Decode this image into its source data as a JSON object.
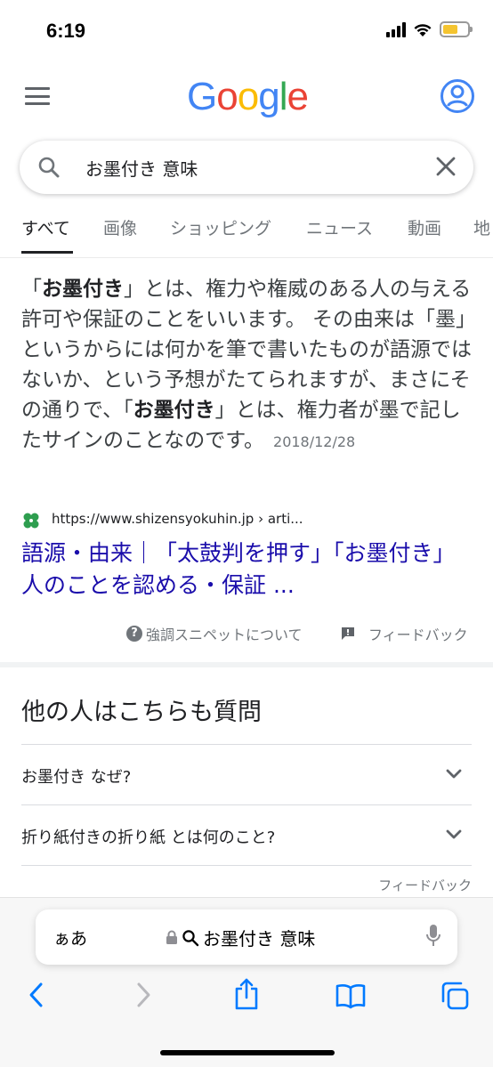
{
  "status": {
    "time": "6:19",
    "battery_level": 0.6
  },
  "header": {
    "logo_letters": [
      "G",
      "o",
      "o",
      "g",
      "l",
      "e"
    ],
    "logo_colors": [
      "#4285F4",
      "#EA4335",
      "#FBBC05",
      "#4285F4",
      "#34A853",
      "#EA4335"
    ]
  },
  "search": {
    "query": "お墨付き 意味"
  },
  "tabs": [
    {
      "label": "すべて"
    },
    {
      "label": "画像"
    },
    {
      "label": "ショッピング"
    },
    {
      "label": "ニュース"
    },
    {
      "label": "動画"
    },
    {
      "label": "地"
    }
  ],
  "snippet": {
    "parts": [
      "「",
      "お墨付き",
      "」とは、権力や権威のある人の与える許可や保証のことをいいます。 その由来は「墨」というからには何かを筆で書いたものが語源ではないか、という予想がたてられますが、まさにその通りで、「",
      "お墨付き",
      "」とは、権力者が墨で記したサインのことなのです。"
    ],
    "date": "2018/12/28",
    "source_url": "https://www.shizensyokuhin.jp › arti...",
    "result_title": "語源・由来｜「太鼓判を押す」「お墨付き」 人のことを認める・保証 ...",
    "about_label": "強調スニペットについて",
    "feedback_label": "フィードバック"
  },
  "paa": {
    "title": "他の人はこちらも質問",
    "questions": [
      "お墨付き なぜ?",
      "折り紙付きの折り紙 とは何のこと?"
    ],
    "feedback_label": "フィードバック"
  },
  "safari": {
    "aa_label": "ぁあ",
    "address_text": "お墨付き 意味"
  },
  "icons": {
    "menu": "hamburger-menu-icon",
    "account": "account-circle-icon",
    "search": "search-icon",
    "clear": "close-icon",
    "back": "chevron-left-icon",
    "forward": "chevron-right-icon",
    "share": "share-icon",
    "bookmarks": "book-icon",
    "tabs": "tabs-icon",
    "mic": "microphone-icon",
    "lock": "lock-icon"
  },
  "colors": {
    "link": "#1a0dab",
    "google_blue": "#4285F4"
  }
}
